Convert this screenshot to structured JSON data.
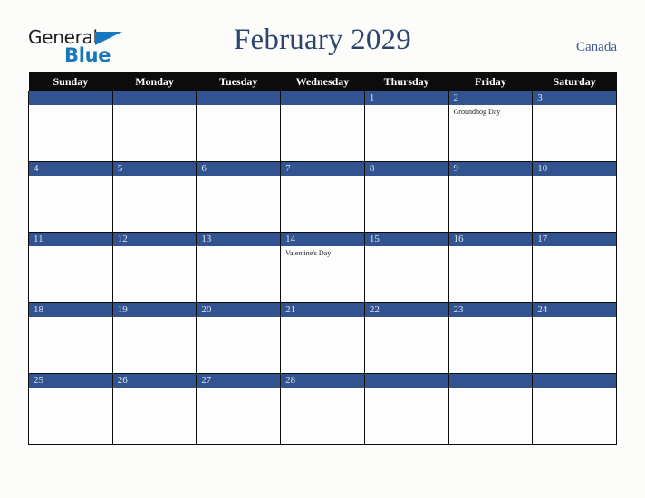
{
  "brand": {
    "name_part1": "General",
    "name_part2": "Blue",
    "triangle_color": "#1878be"
  },
  "header": {
    "title": "February 2029",
    "country": "Canada",
    "title_color": "#2e4470"
  },
  "calendar": {
    "weekday_headers": [
      "Sunday",
      "Monday",
      "Tuesday",
      "Wednesday",
      "Thursday",
      "Friday",
      "Saturday"
    ],
    "header_bg": "#0c0c0c",
    "daynum_bg": "#31538f",
    "daynum_color": "#dfe4ee",
    "weeks": [
      [
        {
          "day": "",
          "events": []
        },
        {
          "day": "",
          "events": []
        },
        {
          "day": "",
          "events": []
        },
        {
          "day": "",
          "events": []
        },
        {
          "day": "1",
          "events": []
        },
        {
          "day": "2",
          "events": [
            "Groundhog Day"
          ]
        },
        {
          "day": "3",
          "events": []
        }
      ],
      [
        {
          "day": "4",
          "events": []
        },
        {
          "day": "5",
          "events": []
        },
        {
          "day": "6",
          "events": []
        },
        {
          "day": "7",
          "events": []
        },
        {
          "day": "8",
          "events": []
        },
        {
          "day": "9",
          "events": []
        },
        {
          "day": "10",
          "events": []
        }
      ],
      [
        {
          "day": "11",
          "events": []
        },
        {
          "day": "12",
          "events": []
        },
        {
          "day": "13",
          "events": []
        },
        {
          "day": "14",
          "events": [
            "Valentine's Day"
          ]
        },
        {
          "day": "15",
          "events": []
        },
        {
          "day": "16",
          "events": []
        },
        {
          "day": "17",
          "events": []
        }
      ],
      [
        {
          "day": "18",
          "events": []
        },
        {
          "day": "19",
          "events": []
        },
        {
          "day": "20",
          "events": []
        },
        {
          "day": "21",
          "events": []
        },
        {
          "day": "22",
          "events": []
        },
        {
          "day": "23",
          "events": []
        },
        {
          "day": "24",
          "events": []
        }
      ],
      [
        {
          "day": "25",
          "events": []
        },
        {
          "day": "26",
          "events": []
        },
        {
          "day": "27",
          "events": []
        },
        {
          "day": "28",
          "events": []
        },
        {
          "day": "",
          "events": []
        },
        {
          "day": "",
          "events": []
        },
        {
          "day": "",
          "events": []
        }
      ]
    ]
  }
}
